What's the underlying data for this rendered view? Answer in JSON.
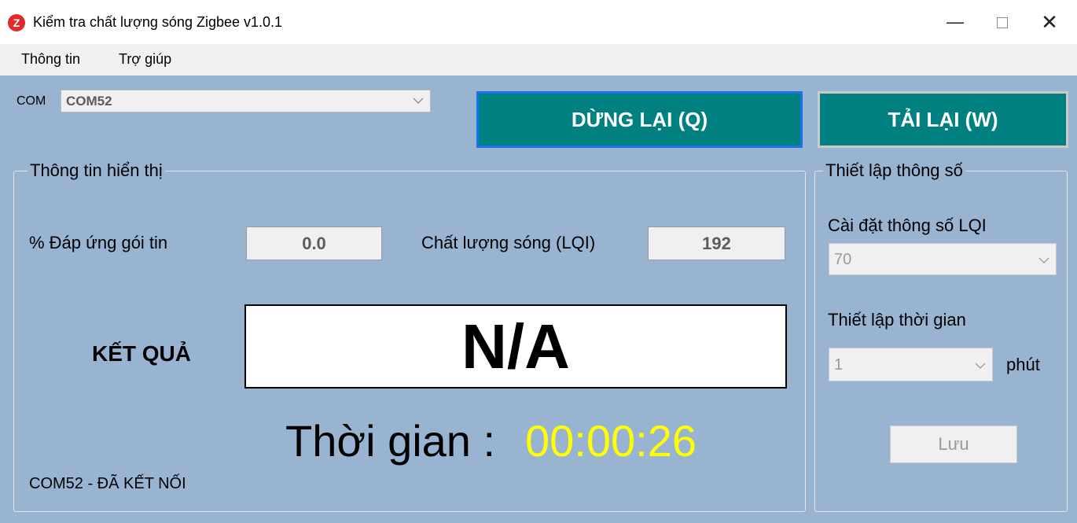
{
  "window": {
    "title": "Kiểm tra chất lượng sóng Zigbee v1.0.1",
    "app_icon_glyph": "Z",
    "minimize_glyph": "—",
    "close_glyph": "✕"
  },
  "menu": {
    "items": [
      {
        "label": "Thông tin"
      },
      {
        "label": "Trợ giúp"
      }
    ]
  },
  "connection": {
    "com_label": "COM",
    "com_port": "COM52"
  },
  "toolbar": {
    "stop_label": "DỪNG LẠI (Q)",
    "reload_label": "TẢI LẠI (W)",
    "accent_color": "#008080"
  },
  "display_info": {
    "legend": "Thông tin hiển thị",
    "packet_response_label": "% Đáp ứng gói tin",
    "packet_response_value": "0.0",
    "lqi_label": "Chất lượng sóng (LQI)",
    "lqi_value": "192",
    "result_label": "KẾT QUẢ",
    "result_value": "N/A",
    "time_label": "Thời gian :",
    "time_value": "00:00:26",
    "status": "COM52 - ĐÃ KẾT NỐI"
  },
  "settings": {
    "legend": "Thiết lập thông số",
    "lqi_setting_label": "Cài đặt thông số LQI",
    "lqi_setting_value": "70",
    "time_setting_label": "Thiết lập thời gian",
    "time_setting_value": "1",
    "time_unit": "phút",
    "save_label": "Lưu"
  },
  "colors": {
    "panel_background": "#99b4d1",
    "timer_color": "#ffff00",
    "focus_border": "#1a73e8"
  },
  "icons": [
    "zigbee-app-icon",
    "minimize-icon",
    "maximize-icon",
    "close-icon",
    "chevron-down-icon"
  ]
}
